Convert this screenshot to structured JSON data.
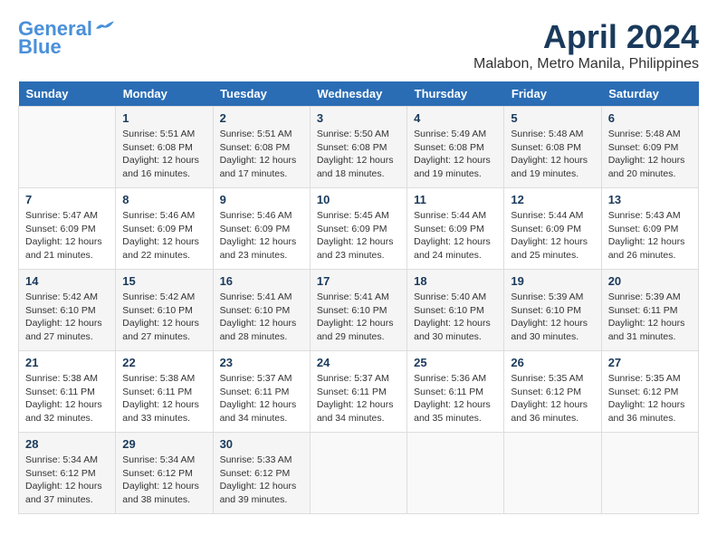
{
  "header": {
    "logo_line1": "General",
    "logo_line2": "Blue",
    "month": "April 2024",
    "location": "Malabon, Metro Manila, Philippines"
  },
  "weekdays": [
    "Sunday",
    "Monday",
    "Tuesday",
    "Wednesday",
    "Thursday",
    "Friday",
    "Saturday"
  ],
  "weeks": [
    [
      {
        "day": "",
        "info": ""
      },
      {
        "day": "1",
        "info": "Sunrise: 5:51 AM\nSunset: 6:08 PM\nDaylight: 12 hours and 16 minutes."
      },
      {
        "day": "2",
        "info": "Sunrise: 5:51 AM\nSunset: 6:08 PM\nDaylight: 12 hours and 17 minutes."
      },
      {
        "day": "3",
        "info": "Sunrise: 5:50 AM\nSunset: 6:08 PM\nDaylight: 12 hours and 18 minutes."
      },
      {
        "day": "4",
        "info": "Sunrise: 5:49 AM\nSunset: 6:08 PM\nDaylight: 12 hours and 19 minutes."
      },
      {
        "day": "5",
        "info": "Sunrise: 5:48 AM\nSunset: 6:08 PM\nDaylight: 12 hours and 19 minutes."
      },
      {
        "day": "6",
        "info": "Sunrise: 5:48 AM\nSunset: 6:09 PM\nDaylight: 12 hours and 20 minutes."
      }
    ],
    [
      {
        "day": "7",
        "info": "Sunrise: 5:47 AM\nSunset: 6:09 PM\nDaylight: 12 hours and 21 minutes."
      },
      {
        "day": "8",
        "info": "Sunrise: 5:46 AM\nSunset: 6:09 PM\nDaylight: 12 hours and 22 minutes."
      },
      {
        "day": "9",
        "info": "Sunrise: 5:46 AM\nSunset: 6:09 PM\nDaylight: 12 hours and 23 minutes."
      },
      {
        "day": "10",
        "info": "Sunrise: 5:45 AM\nSunset: 6:09 PM\nDaylight: 12 hours and 23 minutes."
      },
      {
        "day": "11",
        "info": "Sunrise: 5:44 AM\nSunset: 6:09 PM\nDaylight: 12 hours and 24 minutes."
      },
      {
        "day": "12",
        "info": "Sunrise: 5:44 AM\nSunset: 6:09 PM\nDaylight: 12 hours and 25 minutes."
      },
      {
        "day": "13",
        "info": "Sunrise: 5:43 AM\nSunset: 6:09 PM\nDaylight: 12 hours and 26 minutes."
      }
    ],
    [
      {
        "day": "14",
        "info": "Sunrise: 5:42 AM\nSunset: 6:10 PM\nDaylight: 12 hours and 27 minutes."
      },
      {
        "day": "15",
        "info": "Sunrise: 5:42 AM\nSunset: 6:10 PM\nDaylight: 12 hours and 27 minutes."
      },
      {
        "day": "16",
        "info": "Sunrise: 5:41 AM\nSunset: 6:10 PM\nDaylight: 12 hours and 28 minutes."
      },
      {
        "day": "17",
        "info": "Sunrise: 5:41 AM\nSunset: 6:10 PM\nDaylight: 12 hours and 29 minutes."
      },
      {
        "day": "18",
        "info": "Sunrise: 5:40 AM\nSunset: 6:10 PM\nDaylight: 12 hours and 30 minutes."
      },
      {
        "day": "19",
        "info": "Sunrise: 5:39 AM\nSunset: 6:10 PM\nDaylight: 12 hours and 30 minutes."
      },
      {
        "day": "20",
        "info": "Sunrise: 5:39 AM\nSunset: 6:11 PM\nDaylight: 12 hours and 31 minutes."
      }
    ],
    [
      {
        "day": "21",
        "info": "Sunrise: 5:38 AM\nSunset: 6:11 PM\nDaylight: 12 hours and 32 minutes."
      },
      {
        "day": "22",
        "info": "Sunrise: 5:38 AM\nSunset: 6:11 PM\nDaylight: 12 hours and 33 minutes."
      },
      {
        "day": "23",
        "info": "Sunrise: 5:37 AM\nSunset: 6:11 PM\nDaylight: 12 hours and 34 minutes."
      },
      {
        "day": "24",
        "info": "Sunrise: 5:37 AM\nSunset: 6:11 PM\nDaylight: 12 hours and 34 minutes."
      },
      {
        "day": "25",
        "info": "Sunrise: 5:36 AM\nSunset: 6:11 PM\nDaylight: 12 hours and 35 minutes."
      },
      {
        "day": "26",
        "info": "Sunrise: 5:35 AM\nSunset: 6:12 PM\nDaylight: 12 hours and 36 minutes."
      },
      {
        "day": "27",
        "info": "Sunrise: 5:35 AM\nSunset: 6:12 PM\nDaylight: 12 hours and 36 minutes."
      }
    ],
    [
      {
        "day": "28",
        "info": "Sunrise: 5:34 AM\nSunset: 6:12 PM\nDaylight: 12 hours and 37 minutes."
      },
      {
        "day": "29",
        "info": "Sunrise: 5:34 AM\nSunset: 6:12 PM\nDaylight: 12 hours and 38 minutes."
      },
      {
        "day": "30",
        "info": "Sunrise: 5:33 AM\nSunset: 6:12 PM\nDaylight: 12 hours and 39 minutes."
      },
      {
        "day": "",
        "info": ""
      },
      {
        "day": "",
        "info": ""
      },
      {
        "day": "",
        "info": ""
      },
      {
        "day": "",
        "info": ""
      }
    ]
  ]
}
